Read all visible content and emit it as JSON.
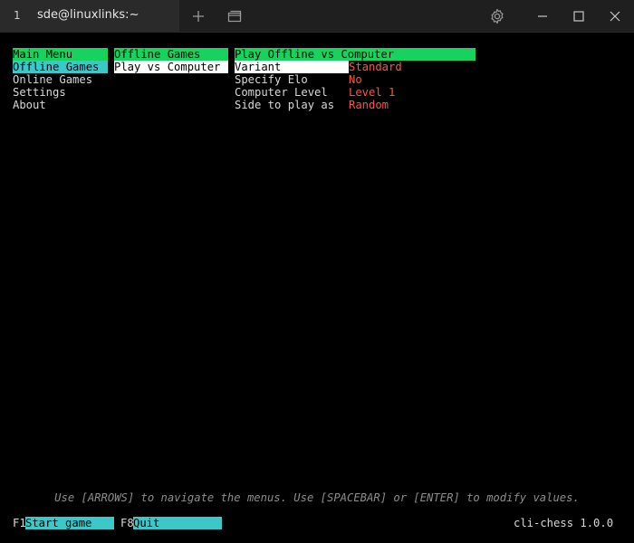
{
  "titlebar": {
    "tab_number": "1",
    "tab_title": "sde@linuxlinks:~"
  },
  "icons": {
    "new_tab": "plus-icon",
    "tabs_overview": "windows-icon",
    "settings": "gear-icon",
    "minimize": "minimize-icon",
    "maximize": "maximize-icon",
    "close": "close-icon"
  },
  "main_menu": {
    "header": "Main Menu",
    "items": [
      "Offline Games",
      "Online Games",
      "Settings",
      "About"
    ],
    "selected_index": 0
  },
  "offline_menu": {
    "header": "Offline Games",
    "items": [
      "Play vs Computer"
    ],
    "selected_index": 0
  },
  "options_panel": {
    "header": "Play Offline vs Computer",
    "rows": [
      {
        "label": "Variant",
        "value": "Standard"
      },
      {
        "label": "Specify Elo",
        "value": "No"
      },
      {
        "label": "Computer Level",
        "value": "Level 1"
      },
      {
        "label": "Side to play as",
        "value": "Random"
      }
    ],
    "selected_index": 0
  },
  "hint": "Use [ARROWS] to navigate the menus. Use [SPACEBAR] or [ENTER] to modify values.",
  "footer": {
    "f1_key": "F1",
    "f1_label": "Start game",
    "f8_key": "F8",
    "f8_label": "Quit",
    "version": "cli-chess 1.0.0"
  },
  "colors": {
    "header_bg": "#17d35d",
    "selected_bg": "#3cc8c8",
    "focused_bg": "#ffffff",
    "value_text": "#ff5733",
    "hint_text": "#8c8c8c"
  }
}
